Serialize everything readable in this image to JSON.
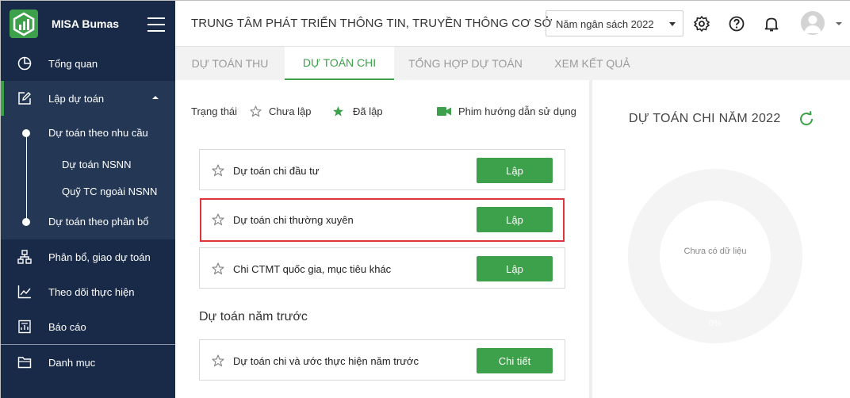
{
  "app": {
    "name": "MISA Bumas"
  },
  "sidebar": {
    "items": [
      {
        "label": "Tổng quan",
        "icon": "pie-chart-icon"
      },
      {
        "label": "Lập dự toán",
        "icon": "edit-icon"
      },
      {
        "label": "Phân bổ, giao dự toán",
        "icon": "sitemap-icon"
      },
      {
        "label": "Theo dõi thực hiện",
        "icon": "line-chart-icon"
      },
      {
        "label": "Báo cáo",
        "icon": "report-icon"
      },
      {
        "label": "Danh mục",
        "icon": "folder-icon"
      }
    ],
    "sub_items": [
      {
        "label": "Dự toán theo nhu cầu"
      },
      {
        "label": "Dự toán NSNN"
      },
      {
        "label": "Quỹ TC ngoài NSNN"
      },
      {
        "label": "Dự toán theo phân bổ"
      }
    ]
  },
  "header": {
    "org_title": "TRUNG TÂM PHÁT TRIỂN THÔNG TIN, TRUYỀN THÔNG CƠ SỞ",
    "year_select": "Năm ngân sách 2022"
  },
  "tabs": [
    {
      "label": "DỰ TOÁN THU"
    },
    {
      "label": "DỰ TOÁN CHI"
    },
    {
      "label": "TỔNG HỢP DỰ TOÁN"
    },
    {
      "label": "XEM KẾT QUẢ"
    }
  ],
  "status": {
    "label": "Trạng thái",
    "not_created": "Chưa lập",
    "created": "Đã lập",
    "video_guide": "Phim hướng dẫn sử dụng"
  },
  "cards": [
    {
      "label": "Dự toán chi đầu tư",
      "button": "Lập"
    },
    {
      "label": "Dự toán chi thường xuyên",
      "button": "Lập"
    },
    {
      "label": "Chi CTMT quốc gia, mục tiêu khác",
      "button": "Lập"
    }
  ],
  "previous_year": {
    "title": "Dự toán năm trước",
    "cards": [
      {
        "label": "Dự toán chi và ước thực hiện năm trước",
        "button": "Chi tiết"
      }
    ]
  },
  "chart_panel": {
    "title": "DỰ TOÁN CHI NĂM 2022",
    "no_data": "Chưa có dữ liệu",
    "percent": "0%"
  },
  "colors": {
    "sidebar": "#192a48",
    "accent": "#3da04a",
    "highlight": "#e0343c"
  }
}
